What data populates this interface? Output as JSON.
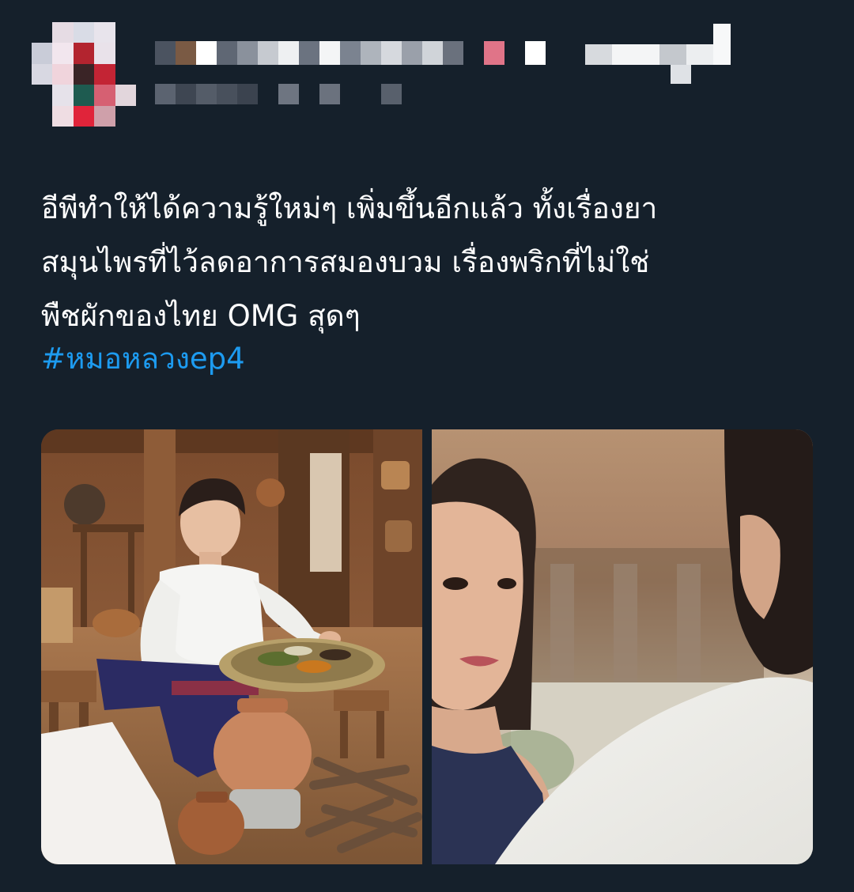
{
  "tweet": {
    "lines": [
      "อีพีทำให้ได้ความรู้ใหม่ๆ เพิ่มขึ้นอีกแล้ว ทั้งเรื่องยา",
      "สมุนไพรที่ไว้ลดอาการสมองบวม เรื่องพริกที่ไม่ใช่",
      "พืชผักของไทย OMG สุดๆ"
    ],
    "hashtag": "#หมอหลวงep4"
  },
  "author": {
    "avatar_icon": "pixelated-avatar-icon",
    "display_name_icon": "pixelated-display-name",
    "handle_icon": "pixelated-handle"
  },
  "media": [
    {
      "icon": "photo-man-preparing-herbs"
    },
    {
      "icon": "photo-woman-smiling"
    }
  ],
  "colors": {
    "background": "#15202b",
    "text": "#ffffff",
    "link": "#1d9bf0"
  }
}
